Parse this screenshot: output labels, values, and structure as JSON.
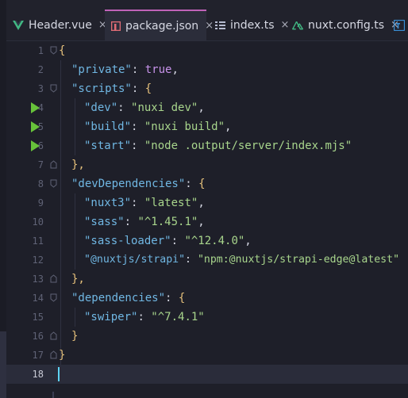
{
  "tabs": [
    {
      "label": "Header.vue",
      "icon": "vue-icon",
      "active": false
    },
    {
      "label": "package.json",
      "icon": "npm-icon",
      "active": true
    },
    {
      "label": "index.ts",
      "icon": "list-icon",
      "active": false
    },
    {
      "label": "nuxt.config.ts",
      "icon": "nuxt-icon",
      "active": false
    }
  ],
  "close_glyph": "×",
  "line_numbers": [
    "1",
    "2",
    "3",
    "4",
    "5",
    "6",
    "7",
    "8",
    "9",
    "10",
    "11",
    "12",
    "13",
    "14",
    "15",
    "16",
    "17",
    "18"
  ],
  "code": {
    "open_brace": "{",
    "private_key": "\"private\"",
    "private_val": "true",
    "scripts_key": "\"scripts\"",
    "dev_key": "\"dev\"",
    "dev_val": "\"nuxi dev\"",
    "build_key": "\"build\"",
    "build_val": "\"nuxi build\"",
    "start_key": "\"start\"",
    "start_val": "\"node .output/server/index.mjs\"",
    "devdeps_key": "\"devDependencies\"",
    "nuxt3_key": "\"nuxt3\"",
    "nuxt3_val": "\"latest\"",
    "sass_key": "\"sass\"",
    "sass_val": "\"^1.45.1\"",
    "sassloader_key": "\"sass-loader\"",
    "sassloader_val": "\"^12.4.0\"",
    "strapi_key": "\"@nuxtjs/strapi\"",
    "strapi_val": "\"npm:@nuxtjs/strapi-edge@latest\"",
    "deps_key": "\"dependencies\"",
    "swiper_key": "\"swiper\"",
    "swiper_val": "\"^7.4.1\"",
    "close_brace": "}",
    "close_brace_comma": "},"
  },
  "colors": {
    "key": "#70b7e3",
    "string": "#a8d58c",
    "boolean": "#c792ea",
    "brace": "#e5c07b",
    "run_arrow": "#67c23a",
    "active_tab_accent": "#c063b8"
  }
}
